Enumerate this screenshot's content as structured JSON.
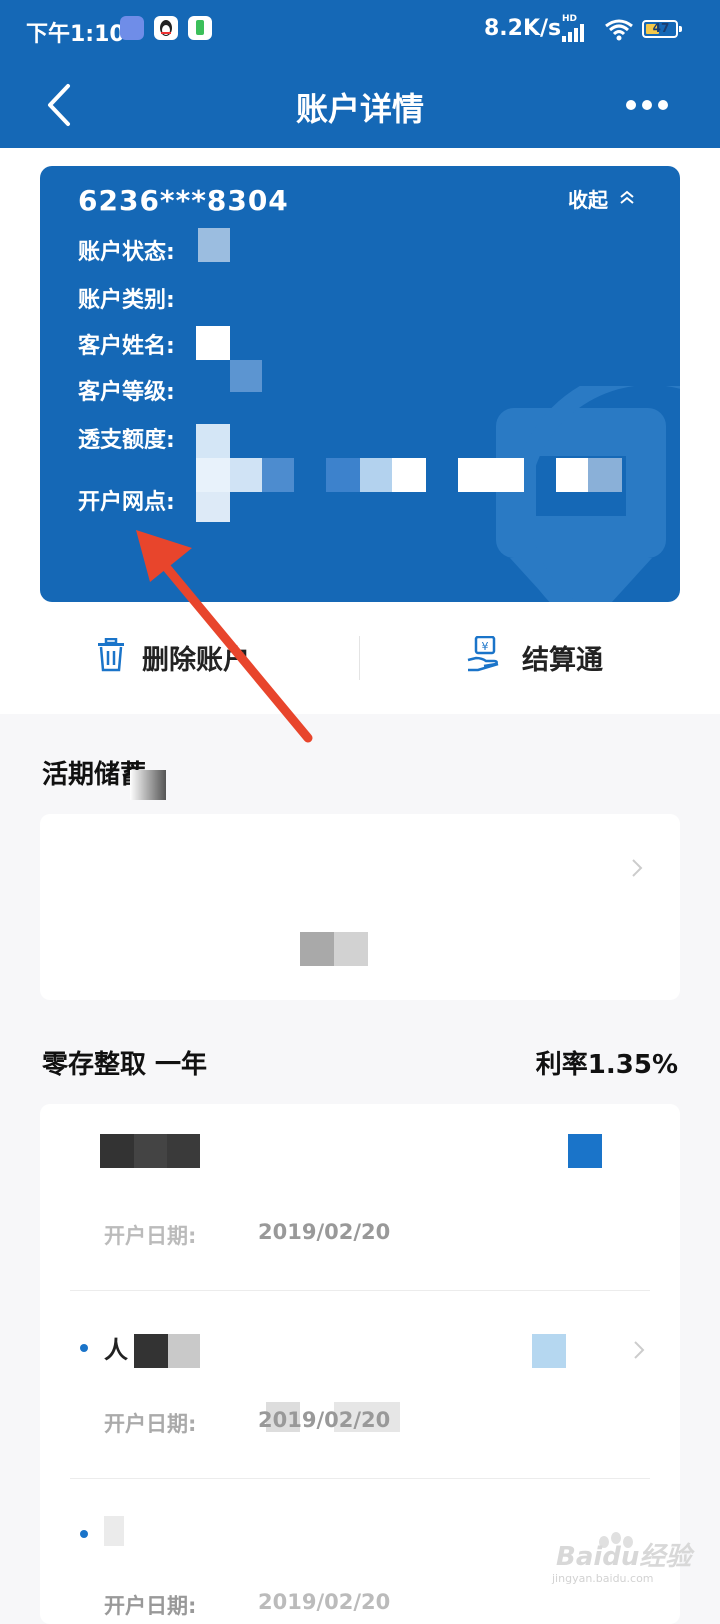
{
  "status_bar": {
    "time": "下午1:10",
    "net_speed": "8.2K/s",
    "hd": "HD",
    "battery": "47",
    "battery_level": 0.47
  },
  "nav": {
    "title": "账户详情"
  },
  "card": {
    "account_number": "6236***8304",
    "collapse_label": "收起",
    "fields": [
      {
        "label": "账户状态:"
      },
      {
        "label": "账户类别:"
      },
      {
        "label": "客户姓名:"
      },
      {
        "label": "客户等级:"
      },
      {
        "label": "透支额度:"
      },
      {
        "label": "开户网点:"
      }
    ]
  },
  "actions": {
    "delete_label": "删除账户",
    "settle_label": "结算通"
  },
  "sections": {
    "demand_title": "活期储蓄",
    "fixed_title": "零存整取  一年",
    "fixed_rate": "利率1.35%"
  },
  "records": {
    "open_date_label": "开户日期:",
    "rows": [
      {
        "date": "2019/02/20"
      },
      {
        "name_prefix": "人",
        "date": "2019/02/20"
      },
      {
        "date": "2019/02/20"
      }
    ]
  },
  "watermark": {
    "text": "Baidu经验",
    "sub": "jingyan.baidu.com"
  },
  "colors": {
    "brand_blue": "#1568b6",
    "accent_red": "#e8452c"
  }
}
